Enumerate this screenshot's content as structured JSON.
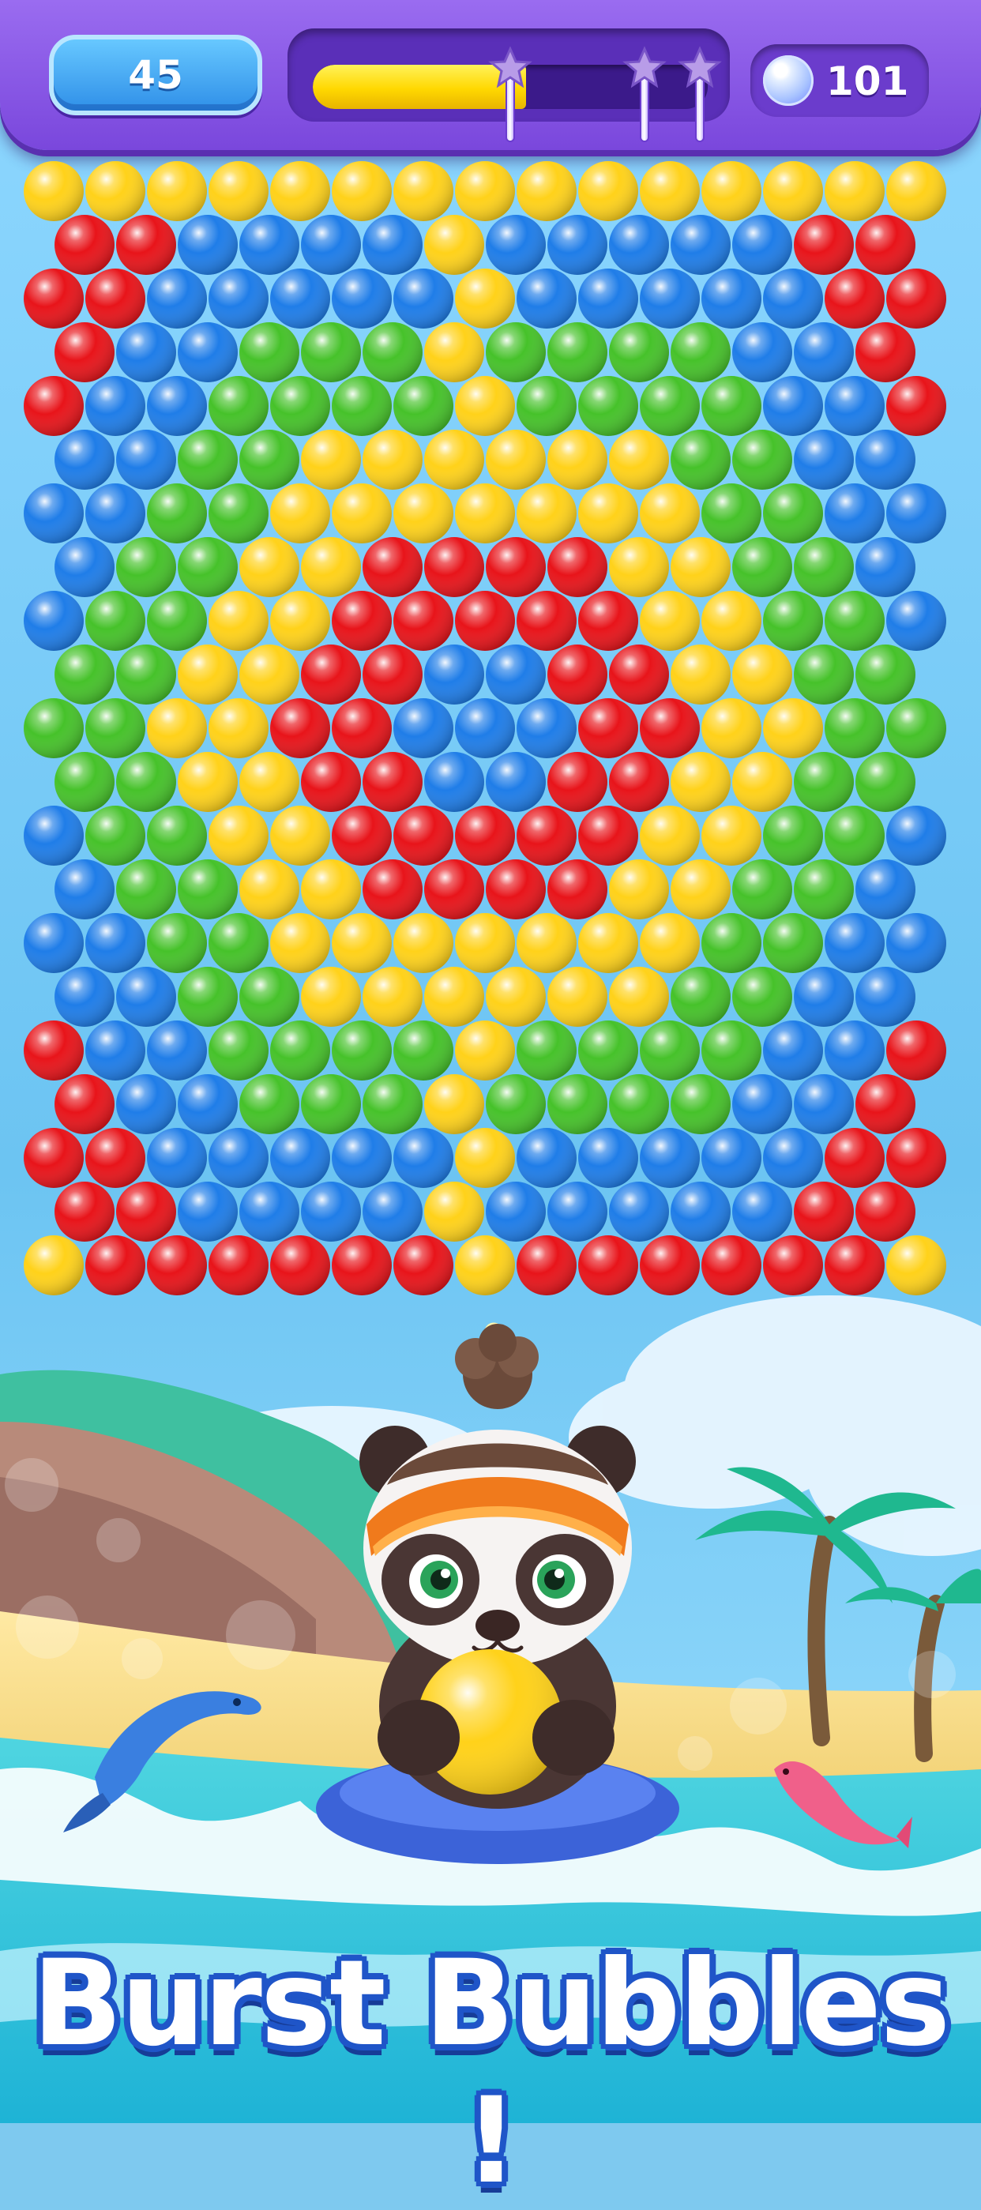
{
  "hud": {
    "moves_left": "45",
    "coins": "101",
    "score_progress": 0.54,
    "star_thresholds": [
      0.5,
      0.84,
      0.98
    ],
    "moves_icon": "moves-counter-badge",
    "coin_icon": "bubble-coin-icon",
    "star_icon": "star-icon"
  },
  "board": {
    "legend": {
      "Y": "#ffd21a",
      "R": "#e8141a",
      "B": "#1f7de8",
      "G": "#46c22a"
    },
    "rows": [
      "YYYYYYYYYYYYYYY",
      "RRBBBBYBBBBBRR",
      "RRBBBBBYBBBBBRR",
      "RBBGGGYGGGGBBR",
      "RBBGGGGYGGGGBBR",
      "BBGGYYYYYYGGBB",
      "BBGGYYYYYYYGGBB",
      "BGGYYRRRRYYGGB",
      "BGGYYRRRRRYYGGB",
      "GGYYRRBBRRYYGG",
      "GGYYRRBBBRRYYGG",
      "GGYYRRBBRRYYGG",
      "BGGYYRRRRRYYGGB",
      "BGGYYRRRRYYGGB",
      "BBGGYYYYYYYGGBB",
      "BBGGYYYYYYGGBB",
      "RBBGGGGYGGGGBBR",
      "RBBGGGYGGGGBBR",
      "RRBBBBBYBBBBBRR",
      "RRBBBBYBBBBBRR",
      "YRRRRRRYRRRRRRY"
    ]
  },
  "shooter": {
    "character": "panda",
    "loaded_bubble": "#ffd21a",
    "aim_dots": 6
  },
  "banner": {
    "text": "Burst Bubbles !"
  }
}
